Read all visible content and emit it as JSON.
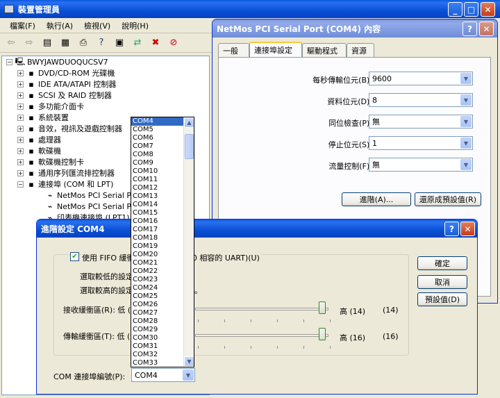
{
  "device_manager": {
    "title": "裝置管理員",
    "menu": [
      "檔案(F)",
      "執行(A)",
      "檢視(V)",
      "說明(H)"
    ],
    "tree": {
      "root": "BWYJAWDUOQUCSV7",
      "nodes": [
        {
          "label": "DVD/CD-ROM 光碟機",
          "icon": "cdrom-icon"
        },
        {
          "label": "IDE ATA/ATAPI 控制器",
          "icon": "ide-icon"
        },
        {
          "label": "SCSI 及 RAID 控制器",
          "icon": "scsi-icon"
        },
        {
          "label": "多功能介面卡",
          "icon": "multifunction-icon"
        },
        {
          "label": "系統裝置",
          "icon": "system-icon"
        },
        {
          "label": "音效，視訊及遊戲控制器",
          "icon": "sound-icon"
        },
        {
          "label": "處理器",
          "icon": "processor-icon"
        },
        {
          "label": "軟碟機",
          "icon": "floppy-icon"
        },
        {
          "label": "軟碟機控制卡",
          "icon": "floppy-controller-icon"
        },
        {
          "label": "通用序列匯流排控制器",
          "icon": "usb-icon"
        },
        {
          "label": "連接埠 (COM 和 LPT)",
          "icon": "port-icon"
        }
      ],
      "ports": [
        "NetMos PCI Serial Port",
        "NetMos PCI Serial Port",
        "印表機連接埠 (LPT1)"
      ]
    }
  },
  "props": {
    "title": "NetMos PCI Serial Port (COM4) 內容",
    "tabs": [
      "一般",
      "連接埠設定",
      "驅動程式",
      "資源"
    ],
    "fields": [
      {
        "label": "每秒傳輸位元(B):",
        "value": "9600"
      },
      {
        "label": "資料位元(D):",
        "value": "8"
      },
      {
        "label": "同位檢查(P):",
        "value": "無"
      },
      {
        "label": "停止位元(S):",
        "value": "1"
      },
      {
        "label": "流量控制(F):",
        "value": "無"
      }
    ],
    "advanced_btn": "進階(A)...",
    "restore_btn": "還原成預設值(R)"
  },
  "advanced": {
    "title": "進階設定 COM4",
    "fifo_label": "使用 FIFO 緩衝區 (必須是 16550 相容的 UART)(U)",
    "low_text": "選取較低的設定以修正連線問題。",
    "high_text": "選取較高的設定以獲得較佳的效能。",
    "rx_label": "接收緩衝區(R): 低 (1)",
    "rx_high": "高 (14)",
    "rx_value": "(14)",
    "rx_level": 1.0,
    "tx_label": "傳輸緩衝區(T): 低 (1)",
    "tx_high": "高 (16)",
    "tx_value": "(16)",
    "tx_level": 1.0,
    "com_label": "COM 連接埠編號(P):",
    "com_value": "COM4",
    "ok": "確定",
    "cancel": "取消",
    "defaults": "預設值(D)"
  },
  "com_list": [
    "COM4",
    "COM5",
    "COM6",
    "COM7",
    "COM8",
    "COM9",
    "COM10",
    "COM11",
    "COM12",
    "COM13",
    "COM14",
    "COM15",
    "COM16",
    "COM17",
    "COM18",
    "COM19",
    "COM20",
    "COM21",
    "COM22",
    "COM23",
    "COM24",
    "COM25",
    "COM26",
    "COM27",
    "COM28",
    "COM29",
    "COM30",
    "COM31",
    "COM32",
    "COM33"
  ],
  "com_selected": 0
}
